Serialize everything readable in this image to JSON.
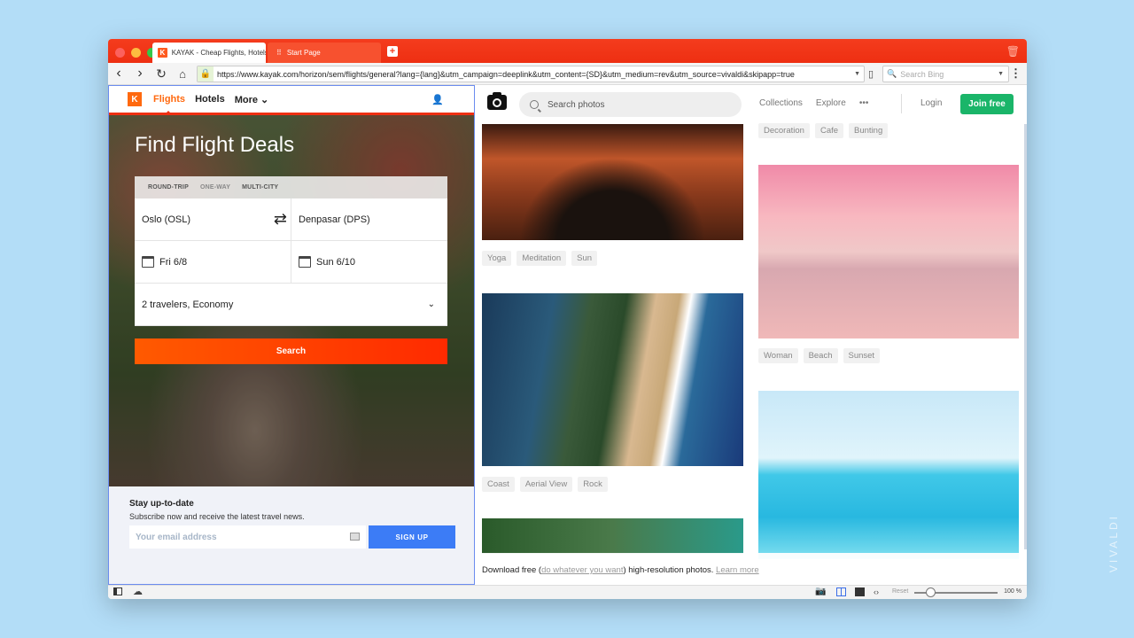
{
  "browser": {
    "tabs": [
      {
        "title": "KAYAK - Cheap Flights, Hotels",
        "favicon": "K",
        "active": true
      },
      {
        "title": "Start Page",
        "active": false
      }
    ],
    "url": "https://www.kayak.com/horizon/sem/flights/general?lang={lang}&utm_campaign=deeplink&utm_content={SD}&utm_medium=rev&utm_source=vivaldi&skipapp=true",
    "search_placeholder": "Search Bing",
    "status": {
      "reset_label": "Reset",
      "zoom": "100 %"
    },
    "watermark": "VIVALDI"
  },
  "kayak": {
    "logo": "K",
    "nav": {
      "flights": "Flights",
      "hotels": "Hotels",
      "more": "More ⌄"
    },
    "title": "Find Flight Deals",
    "trip_types": [
      "ROUND-TRIP",
      "ONE-WAY",
      "MULTI-CITY"
    ],
    "origin": "Oslo (OSL)",
    "destination": "Denpasar (DPS)",
    "depart": "Fri 6/8",
    "return": "Sun 6/10",
    "travelers": "2 travelers, Economy",
    "search_label": "Search",
    "newsletter": {
      "title": "Stay up-to-date",
      "subtitle": "Subscribe now and receive the latest travel news.",
      "email_placeholder": "Your email address",
      "signup_label": "SIGN UP"
    }
  },
  "unsplash": {
    "search_placeholder": "Search photos",
    "nav": {
      "collections": "Collections",
      "explore": "Explore",
      "more": "•••",
      "login": "Login",
      "join": "Join free"
    },
    "tags_top_right": [
      "Decoration",
      "Cafe",
      "Bunting"
    ],
    "tags_photo1": [
      "Yoga",
      "Meditation",
      "Sun"
    ],
    "tags_photo2": [
      "Coast",
      "Aerial View",
      "Rock"
    ],
    "tags_photo3": [
      "Woman",
      "Beach",
      "Sunset"
    ],
    "download": {
      "prefix": "Download free (",
      "link": "do whatever you want",
      "suffix": ") high-resolution photos. ",
      "learn": "Learn more"
    }
  }
}
